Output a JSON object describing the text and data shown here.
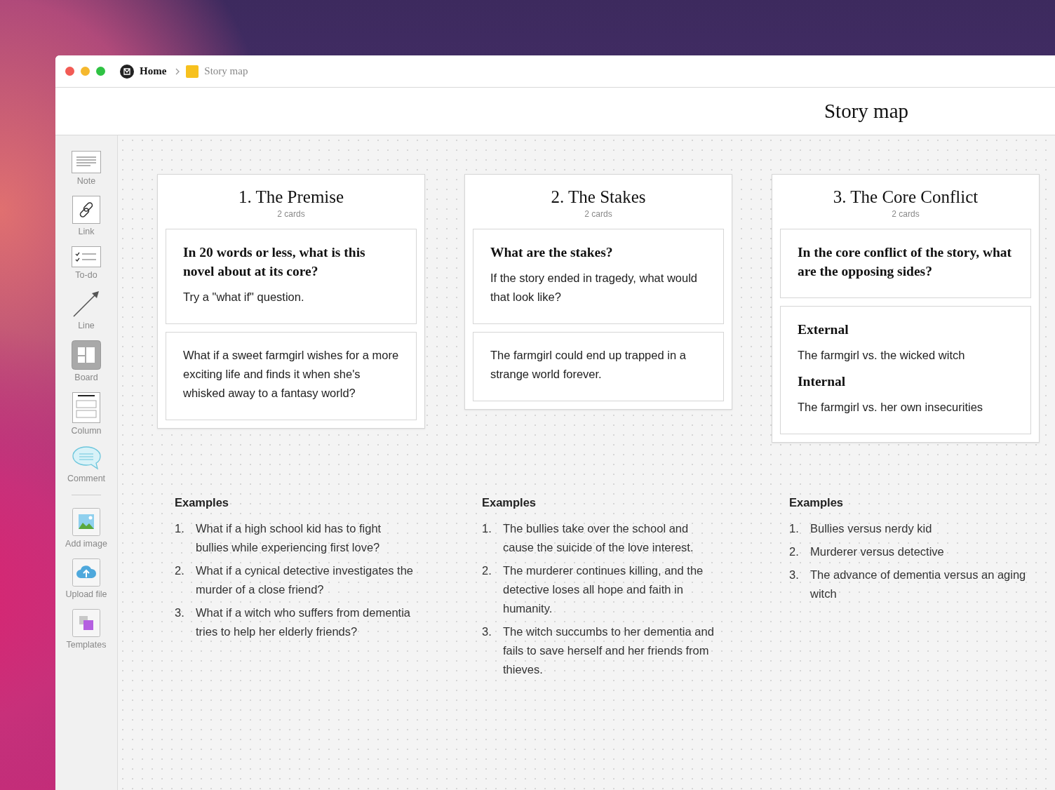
{
  "window": {
    "breadcrumbs": [
      {
        "kind": "home",
        "label": "Home"
      },
      {
        "kind": "board",
        "label": "Story map"
      }
    ]
  },
  "header": {
    "title": "Story map"
  },
  "sidebar": {
    "tools": [
      {
        "kind": "note",
        "label": "Note"
      },
      {
        "kind": "link",
        "label": "Link"
      },
      {
        "kind": "todo",
        "label": "To-do"
      },
      {
        "kind": "line",
        "label": "Line"
      },
      {
        "kind": "board",
        "label": "Board"
      },
      {
        "kind": "column",
        "label": "Column"
      },
      {
        "kind": "comment",
        "label": "Comment"
      }
    ],
    "media_tools": [
      {
        "kind": "image",
        "label": "Add image"
      },
      {
        "kind": "upload",
        "label": "Upload file"
      },
      {
        "kind": "templates",
        "label": "Templates"
      }
    ]
  },
  "columns": [
    {
      "title": "1. The Premise",
      "count": "2 cards",
      "cards": [
        {
          "blocks": [
            {
              "kind": "heading",
              "text": "In 20 words or less, what is this novel about at its core?"
            },
            {
              "kind": "text",
              "text": "Try a \"what if\" question."
            }
          ]
        },
        {
          "blocks": [
            {
              "kind": "text",
              "text": "What if a sweet farmgirl wishes for a more exciting life and finds it when she's whisked away to a fantasy world?"
            }
          ]
        }
      ],
      "examples": {
        "heading": "Examples",
        "items": [
          {
            "number": "1.",
            "text": "What if a high school kid has to fight bullies while experiencing first love?"
          },
          {
            "number": "2.",
            "text": "What if a cynical detective investigates the murder of a close friend?"
          },
          {
            "number": "3.",
            "text": "What if a witch who suffers from dementia tries to help her elderly friends?"
          }
        ]
      }
    },
    {
      "title": "2. The Stakes",
      "count": "2 cards",
      "cards": [
        {
          "blocks": [
            {
              "kind": "heading",
              "text": "What are the stakes?"
            },
            {
              "kind": "text",
              "text": "If the story ended in tragedy, what would that look like?"
            }
          ]
        },
        {
          "blocks": [
            {
              "kind": "text",
              "text": "The farmgirl could end up trapped in a strange world forever."
            }
          ]
        }
      ],
      "examples": {
        "heading": "Examples",
        "items": [
          {
            "number": "1.",
            "text": "The bullies take over the school and cause the suicide of the love interest."
          },
          {
            "number": "2.",
            "text": "The murderer continues killing, and the detective loses all hope and faith in humanity."
          },
          {
            "number": "3.",
            "text": "The witch succumbs to her dementia and fails to save herself and her friends from thieves."
          }
        ]
      }
    },
    {
      "title": "3. The Core Conflict",
      "count": "2 cards",
      "cards": [
        {
          "blocks": [
            {
              "kind": "heading",
              "text": "In the core conflict of the story, what are the opposing sides?"
            }
          ]
        },
        {
          "blocks": [
            {
              "kind": "heading",
              "text": "External"
            },
            {
              "kind": "text",
              "text": "The farmgirl vs. the wicked witch"
            },
            {
              "kind": "heading",
              "text": "Internal"
            },
            {
              "kind": "text",
              "text": "The farmgirl vs. her own insecurities"
            }
          ]
        }
      ],
      "examples": {
        "heading": "Examples",
        "items": [
          {
            "number": "1.",
            "text": "Bullies versus nerdy kid"
          },
          {
            "number": "2.",
            "text": "Murderer versus detective"
          },
          {
            "number": "3.",
            "text": "The advance of dementia versus an aging witch"
          }
        ]
      }
    }
  ]
}
